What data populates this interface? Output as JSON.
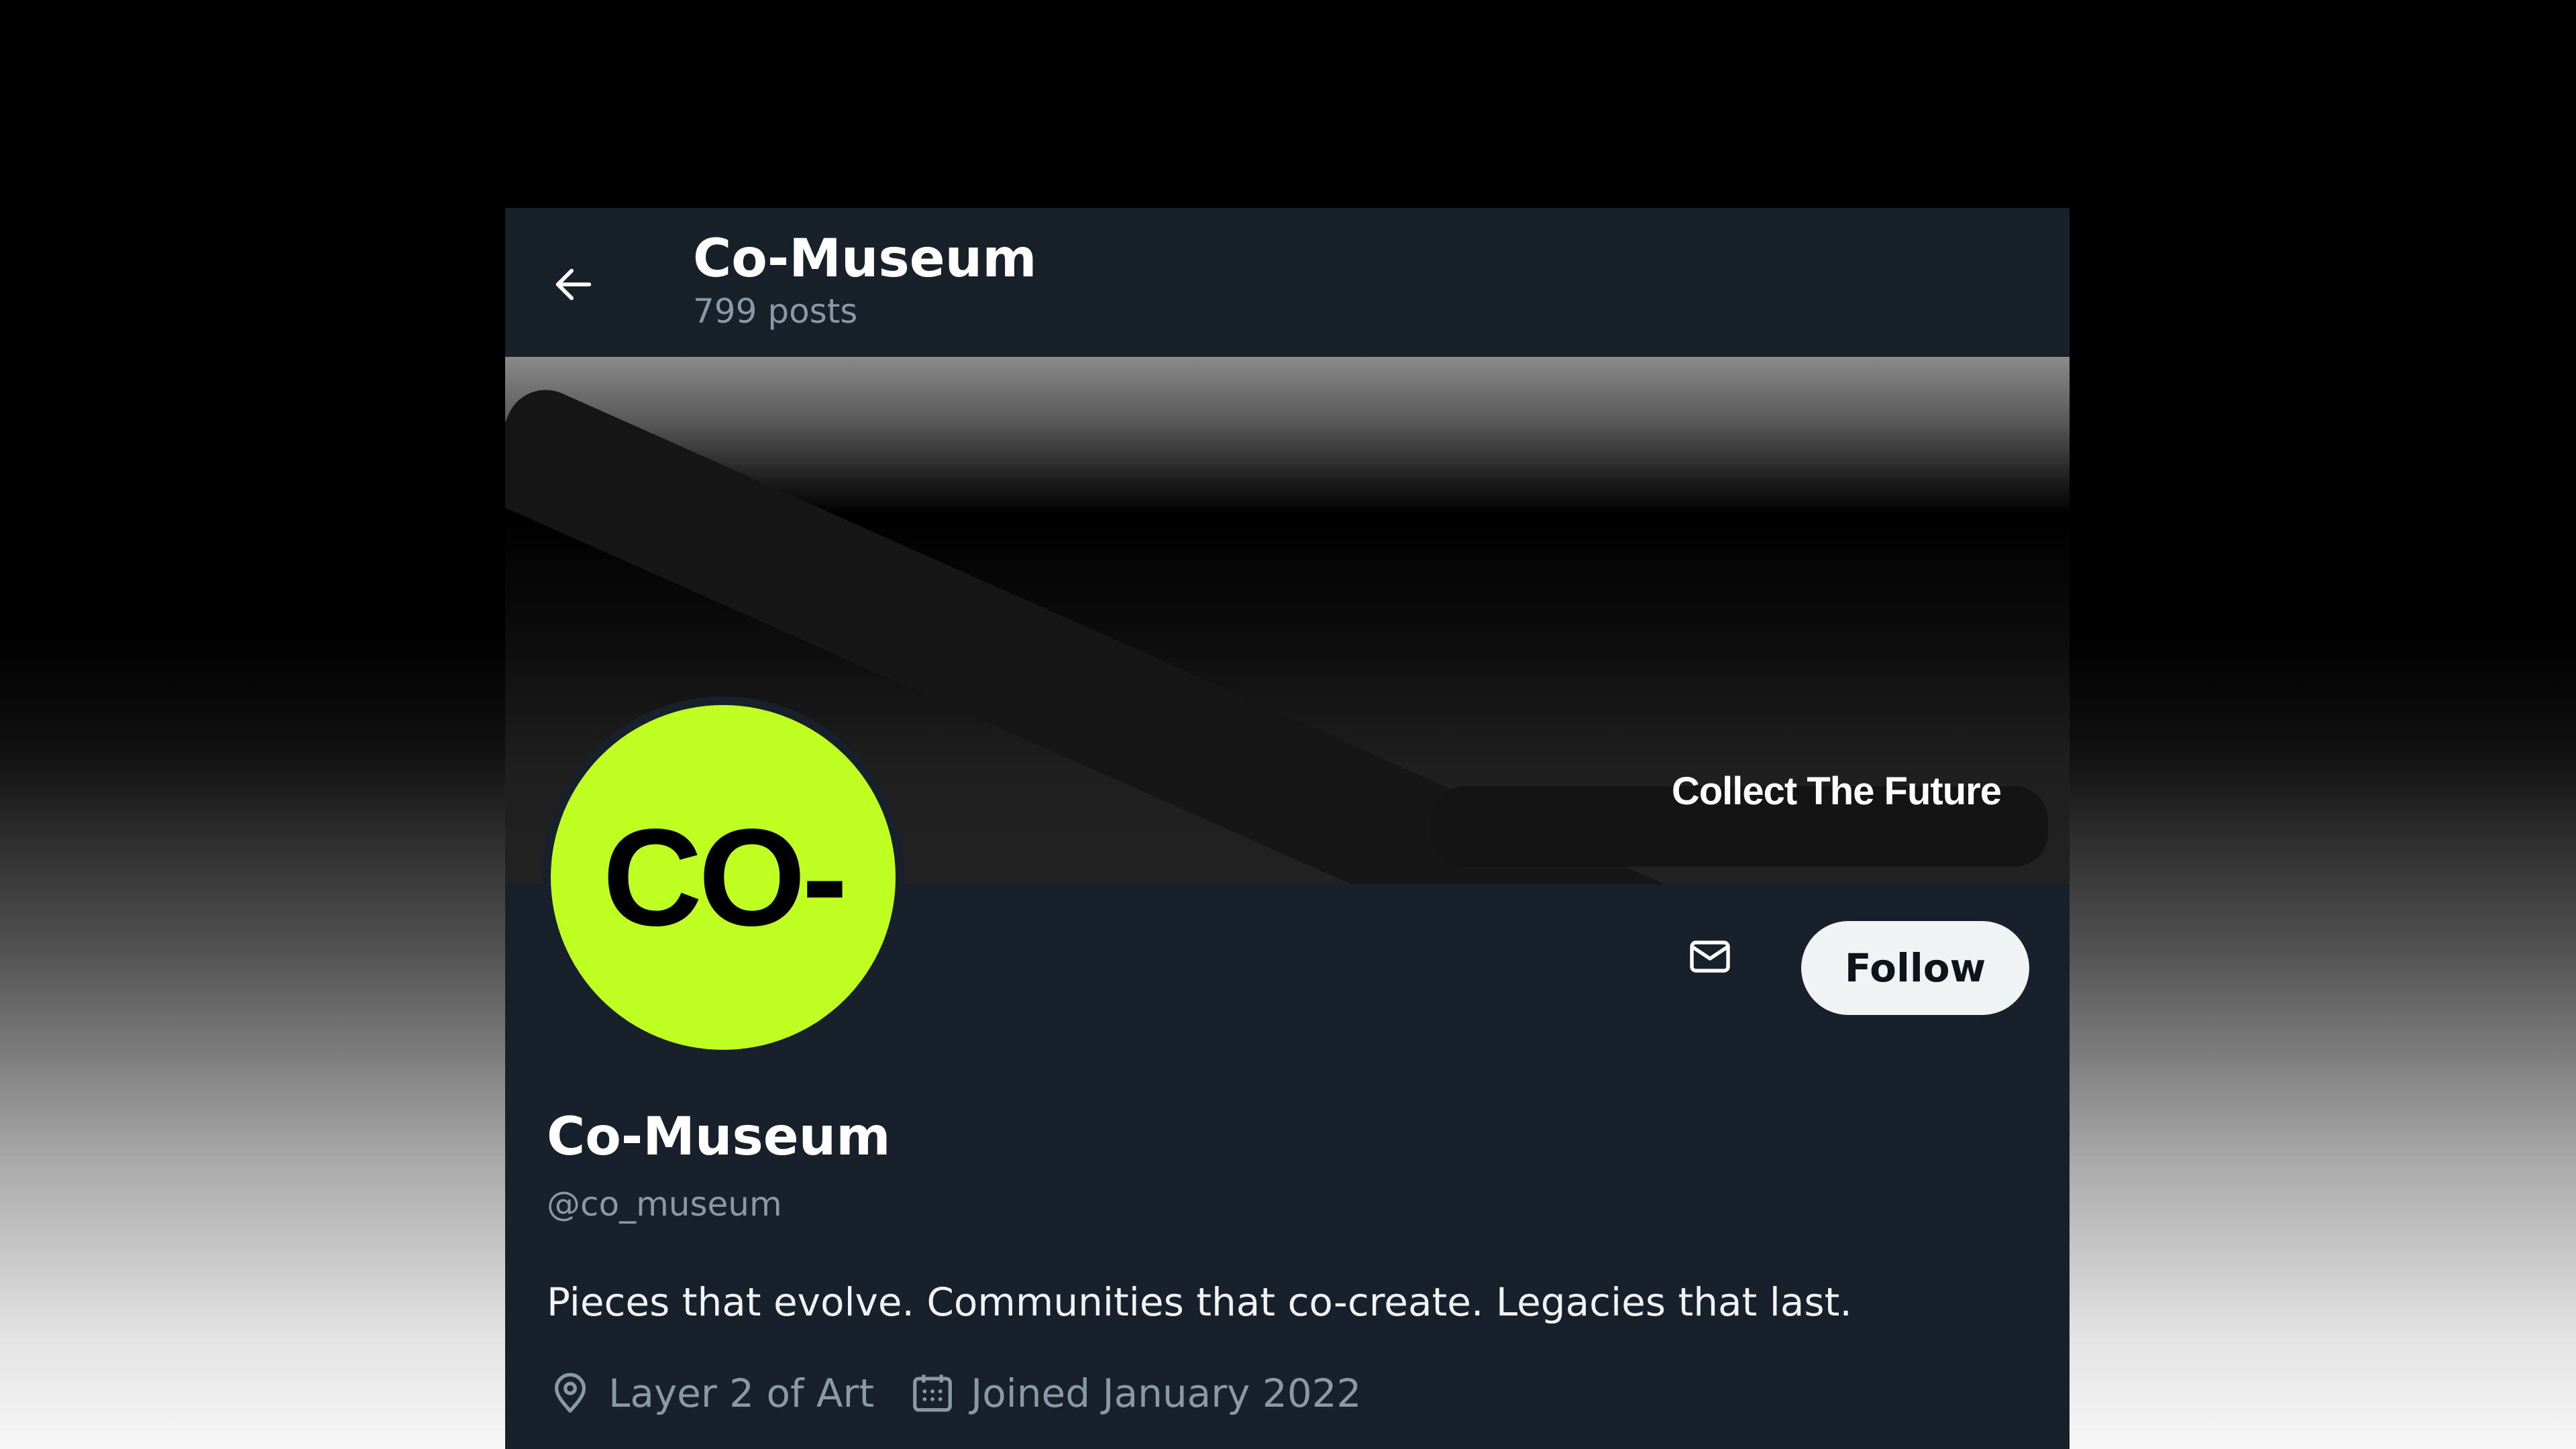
{
  "header": {
    "title": "Co-Museum",
    "posts_count": "799 posts",
    "back_icon": "arrow-left-icon"
  },
  "banner": {
    "tagline": "Collect The Future"
  },
  "avatar": {
    "text": "CO-",
    "background_color": "#c0ff22"
  },
  "actions": {
    "message_icon": "envelope-icon",
    "follow_label": "Follow"
  },
  "profile": {
    "display_name": "Co-Museum",
    "handle": "@co_museum",
    "bio": "Pieces that evolve. Communities that co-create. Legacies that last.",
    "location": "Layer 2 of Art",
    "location_icon": "location-pin-icon",
    "joined": "Joined January 2022",
    "joined_icon": "calendar-icon"
  },
  "colors": {
    "card_bg": "#18212b",
    "text_primary": "#ffffff",
    "text_secondary": "#8b98a5",
    "accent": "#c0ff22",
    "follow_bg": "#eff3f4"
  }
}
